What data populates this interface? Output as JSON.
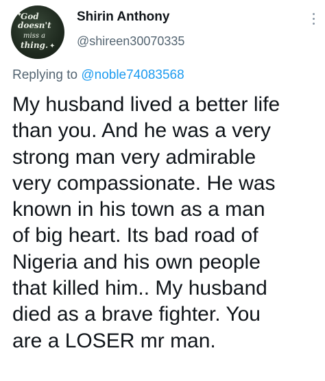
{
  "user": {
    "display_name": "Shirin Anthony",
    "handle": "@shireen30070335",
    "avatar_text": {
      "line1": "God",
      "line2": "doesn't",
      "line3": "miss a",
      "line4": "thing."
    }
  },
  "reply": {
    "prefix": "Replying to ",
    "mention": "@noble74083568"
  },
  "tweet": {
    "text": "My husband lived a better life\nthan you. And he was a very\nstrong man very admirable\nvery compassionate. He was\nknown in his town as a man\nof big heart. Its bad road of\nNigeria and his own people\nthat killed him.. My husband\ndied as a brave fighter. You\nare a LOSER mr man."
  },
  "icons": {
    "more": "more-vertical-icon",
    "sparkle": "sparkle-icon"
  },
  "colors": {
    "text_primary": "#0f1419",
    "text_secondary": "#536471",
    "link": "#1d9bf0",
    "avatar_bg": "#1f2a1f"
  }
}
